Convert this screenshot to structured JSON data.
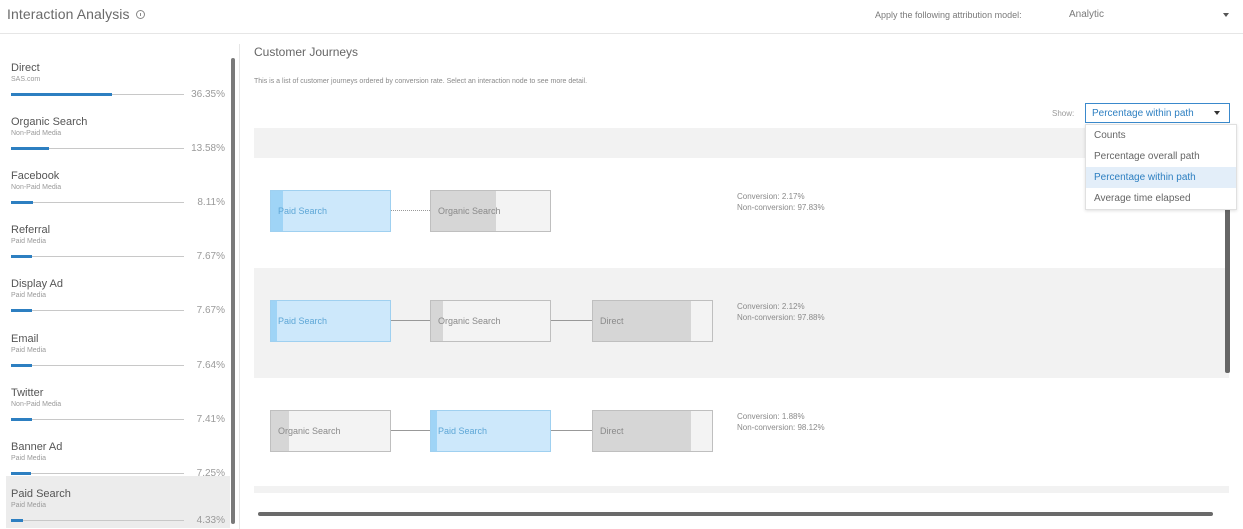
{
  "header": {
    "title": "Interaction Analysis",
    "attribution_label": "Apply the following attribution model:",
    "attribution_value": "Analytic"
  },
  "sidebar": {
    "items": [
      {
        "name": "Direct",
        "sub": "SAS.com",
        "pct": "36.35%",
        "fraction": 0.3635
      },
      {
        "name": "Organic Search",
        "sub": "Non-Paid Media",
        "pct": "13.58%",
        "fraction": 0.1358
      },
      {
        "name": "Facebook",
        "sub": "Non-Paid Media",
        "pct": "8.11%",
        "fraction": 0.0811
      },
      {
        "name": "Referral",
        "sub": "Paid Media",
        "pct": "7.67%",
        "fraction": 0.0767
      },
      {
        "name": "Display Ad",
        "sub": "Paid Media",
        "pct": "7.67%",
        "fraction": 0.0767
      },
      {
        "name": "Email",
        "sub": "Paid Media",
        "pct": "7.64%",
        "fraction": 0.0764
      },
      {
        "name": "Twitter",
        "sub": "Non-Paid Media",
        "pct": "7.41%",
        "fraction": 0.0741
      },
      {
        "name": "Banner Ad",
        "sub": "Paid Media",
        "pct": "7.25%",
        "fraction": 0.0725
      },
      {
        "name": "Paid Search",
        "sub": "Paid Media",
        "pct": "4.33%",
        "fraction": 0.0433,
        "selected": true
      }
    ]
  },
  "main": {
    "title": "Customer Journeys",
    "description": "This is a list of customer journeys ordered by conversion rate. Select an interaction node to see more detail.",
    "show_label": "Show:",
    "show_value": "Percentage within path",
    "menu_options": [
      "Counts",
      "Percentage overall path",
      "Percentage within path",
      "Average time elapsed"
    ],
    "active_option": 2,
    "journeys": [
      {
        "nodes": [
          {
            "label": "Paid Search",
            "color": "blue",
            "fill": 0.1
          },
          {
            "label": "Organic Search",
            "color": "grey",
            "fill": 0.55
          }
        ],
        "conversion": "Conversion: 2.17%",
        "non_conversion": "Non-conversion: 97.83%"
      },
      {
        "nodes": [
          {
            "label": "Paid Search",
            "color": "blue",
            "fill": 0.05
          },
          {
            "label": "Organic Search",
            "color": "grey",
            "fill": 0.1
          },
          {
            "label": "Direct",
            "color": "grey",
            "fill": 0.82
          }
        ],
        "conversion": "Conversion: 2.12%",
        "non_conversion": "Non-conversion: 97.88%"
      },
      {
        "nodes": [
          {
            "label": "Organic Search",
            "color": "grey",
            "fill": 0.15
          },
          {
            "label": "Paid Search",
            "color": "blue",
            "fill": 0.05
          },
          {
            "label": "Direct",
            "color": "grey",
            "fill": 0.82
          }
        ],
        "conversion": "Conversion: 1.88%",
        "non_conversion": "Non-conversion: 98.12%"
      }
    ]
  },
  "colors": {
    "accent": "#2d7fc1",
    "node_blue": "#cde8fb",
    "node_grey": "#f3f3f3"
  }
}
